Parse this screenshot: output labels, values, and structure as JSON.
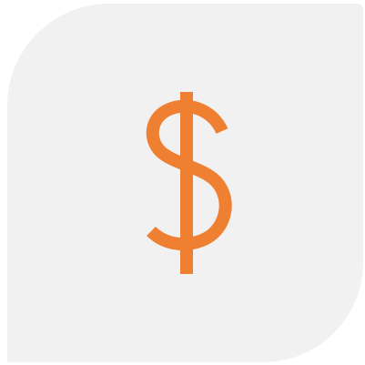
{
  "icon": {
    "name": "dollar-sign-icon",
    "accent_color": "#ef7f31",
    "tile_color": "#f1f1f1"
  }
}
